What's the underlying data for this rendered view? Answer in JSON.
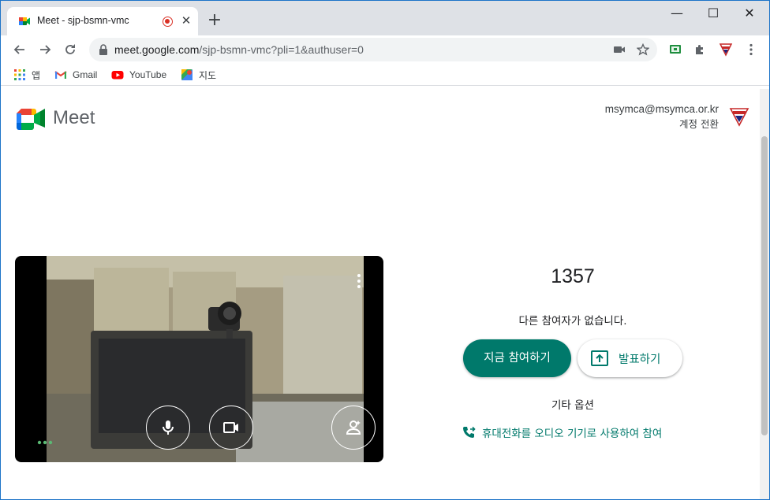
{
  "tab": {
    "title": "Meet - sjp-bsmn-vmc",
    "close_label": "✕"
  },
  "new_tab_label": "+",
  "window_controls": {
    "minimize": "—",
    "maximize": "☐",
    "close": "✕"
  },
  "address_bar": {
    "host": "meet.google.com",
    "path": "/sjp-bsmn-vmc?pli=1&authuser=0"
  },
  "bookmarks": [
    {
      "label": "앱",
      "icon": "apps-grid-icon"
    },
    {
      "label": "Gmail",
      "icon": "gmail-icon"
    },
    {
      "label": "YouTube",
      "icon": "youtube-icon"
    },
    {
      "label": "지도",
      "icon": "maps-icon"
    }
  ],
  "meet": {
    "logo_text": "Meet",
    "account_email": "msymca@msymca.or.kr",
    "switch_account": "계정 전환",
    "meeting_code": "1357",
    "no_participants": "다른 참여자가 없습니다.",
    "join_now": "지금 참여하기",
    "present": "발표하기",
    "other_options": "기타 옵션",
    "phone_audio": "휴대전화를 오디오 기기로 사용하여 참여"
  },
  "colors": {
    "accent": "#00796b",
    "tab_strip": "#dee1e6",
    "window_border": "#1c73c8"
  }
}
